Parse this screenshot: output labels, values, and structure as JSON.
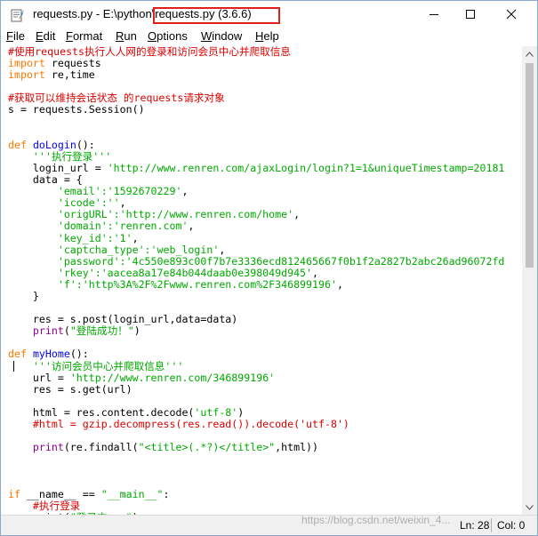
{
  "window": {
    "title_prefix": "requests.py - E:\\python",
    "title_highlighted": "\\requests.py (3.6.6)"
  },
  "menu": {
    "items": [
      {
        "label": "File",
        "underline": "F",
        "rest": "ile"
      },
      {
        "label": "Edit",
        "underline": "E",
        "rest": "dit"
      },
      {
        "label": "Format",
        "underline": "F",
        "rest": "ormat"
      },
      {
        "label": "Run",
        "underline": "R",
        "rest": "un"
      },
      {
        "label": "Options",
        "underline": "O",
        "rest": "ptions"
      },
      {
        "label": "Window",
        "underline": "W",
        "rest": "indow"
      },
      {
        "label": "Help",
        "underline": "H",
        "rest": "elp"
      }
    ]
  },
  "code": {
    "lines": [
      [
        {
          "t": "cm",
          "v": "#使用requests执行人人网的登录和访问会员中心并爬取信息"
        }
      ],
      [
        {
          "t": "kw",
          "v": "import"
        },
        {
          "t": "",
          "v": " requests"
        }
      ],
      [
        {
          "t": "kw",
          "v": "import"
        },
        {
          "t": "",
          "v": " re,time"
        }
      ],
      [],
      [
        {
          "t": "cm",
          "v": "#获取可以维持会话状态 的requests请求对象"
        }
      ],
      [
        {
          "t": "",
          "v": "s = requests.Session()"
        }
      ],
      [],
      [],
      [
        {
          "t": "kw",
          "v": "def"
        },
        {
          "t": "",
          "v": " "
        },
        {
          "t": "df",
          "v": "doLogin"
        },
        {
          "t": "",
          "v": "():"
        }
      ],
      [
        {
          "t": "st",
          "v": "    '''执行登录'''"
        }
      ],
      [
        {
          "t": "",
          "v": "    login_url = "
        },
        {
          "t": "st",
          "v": "'http://www.renren.com/ajaxLogin/login?1=1&uniqueTimestamp=20181"
        }
      ],
      [
        {
          "t": "",
          "v": "    data = {"
        }
      ],
      [
        {
          "t": "st",
          "v": "        'email':'1592670229'"
        },
        {
          "t": "",
          "v": ","
        }
      ],
      [
        {
          "t": "st",
          "v": "        'icode':''"
        },
        {
          "t": "",
          "v": ","
        }
      ],
      [
        {
          "t": "st",
          "v": "        'origURL':'http://www.renren.com/home'"
        },
        {
          "t": "",
          "v": ","
        }
      ],
      [
        {
          "t": "st",
          "v": "        'domain':'renren.com'"
        },
        {
          "t": "",
          "v": ","
        }
      ],
      [
        {
          "t": "st",
          "v": "        'key_id':'1'"
        },
        {
          "t": "",
          "v": ","
        }
      ],
      [
        {
          "t": "st",
          "v": "        'captcha_type':'web_login'"
        },
        {
          "t": "",
          "v": ","
        }
      ],
      [
        {
          "t": "st",
          "v": "        'password':'4c550e893c00f7b7e3336ecd812465667f0b1f2a2827b2abc26ad96072fd"
        }
      ],
      [
        {
          "t": "st",
          "v": "        'rkey':'aacea8a17e84b044daab0e398049d945'"
        },
        {
          "t": "",
          "v": ","
        }
      ],
      [
        {
          "t": "st",
          "v": "        'f':'http%3A%2F%2Fwww.renren.com%2F346899196'"
        },
        {
          "t": "",
          "v": ","
        }
      ],
      [
        {
          "t": "",
          "v": "    }"
        }
      ],
      [],
      [
        {
          "t": "",
          "v": "    res = s.post(login_url,data=data)"
        }
      ],
      [
        {
          "t": "",
          "v": "    "
        },
        {
          "t": "bi",
          "v": "print"
        },
        {
          "t": "",
          "v": "("
        },
        {
          "t": "st",
          "v": "\"登陆成功！\""
        },
        {
          "t": "",
          "v": ")"
        }
      ],
      [],
      [
        {
          "t": "kw",
          "v": "def"
        },
        {
          "t": "",
          "v": " "
        },
        {
          "t": "df",
          "v": "myHome"
        },
        {
          "t": "",
          "v": "():"
        }
      ],
      [
        {
          "t": "st",
          "v": "    '''访问会员中心并爬取信息'''"
        }
      ],
      [
        {
          "t": "",
          "v": "    url = "
        },
        {
          "t": "st",
          "v": "'http://www.renren.com/346899196'"
        }
      ],
      [
        {
          "t": "",
          "v": "    res = s.get(url)"
        }
      ],
      [],
      [
        {
          "t": "",
          "v": "    html = res.content.decode("
        },
        {
          "t": "st",
          "v": "'utf-8'"
        },
        {
          "t": "",
          "v": ")"
        }
      ],
      [
        {
          "t": "cm",
          "v": "    #html = gzip.decompress(res.read()).decode('utf-8')"
        }
      ],
      [],
      [
        {
          "t": "",
          "v": "    "
        },
        {
          "t": "bi",
          "v": "print"
        },
        {
          "t": "",
          "v": "(re.findall("
        },
        {
          "t": "st",
          "v": "\"<title>(.*?)</title>\""
        },
        {
          "t": "",
          "v": ",html))"
        }
      ],
      [],
      [],
      [],
      [
        {
          "t": "kw",
          "v": "if"
        },
        {
          "t": "",
          "v": " __name__ == "
        },
        {
          "t": "st",
          "v": "\"__main__\""
        },
        {
          "t": "",
          "v": ":"
        }
      ],
      [
        {
          "t": "cm",
          "v": "    #执行登录"
        }
      ],
      [
        {
          "t": "",
          "v": "    "
        },
        {
          "t": "bi",
          "v": "print"
        },
        {
          "t": "",
          "v": "("
        },
        {
          "t": "st",
          "v": "\"登录中...\""
        },
        {
          "t": "",
          "v": ")"
        }
      ]
    ]
  },
  "status": {
    "ln": "Ln: 28",
    "col": "Col: 0"
  },
  "watermark": "https://blog.csdn.net/weixin_4..."
}
